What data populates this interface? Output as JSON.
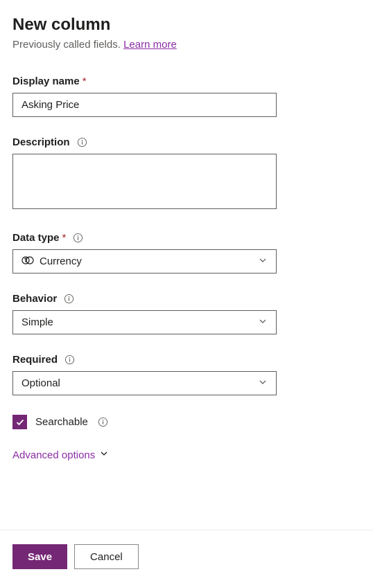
{
  "header": {
    "title": "New column",
    "subtitle_prefix": "Previously called fields. ",
    "learn_more": "Learn more"
  },
  "fields": {
    "display_name": {
      "label": "Display name",
      "required": true,
      "value": "Asking Price"
    },
    "description": {
      "label": "Description",
      "has_info": true,
      "value": ""
    },
    "data_type": {
      "label": "Data type",
      "required": true,
      "has_info": true,
      "selected": "Currency"
    },
    "behavior": {
      "label": "Behavior",
      "has_info": true,
      "selected": "Simple"
    },
    "required_field": {
      "label": "Required",
      "has_info": true,
      "selected": "Optional"
    },
    "searchable": {
      "label": "Searchable",
      "checked": true,
      "has_info": true
    }
  },
  "advanced": {
    "label": "Advanced options"
  },
  "footer": {
    "save": "Save",
    "cancel": "Cancel"
  },
  "colors": {
    "accent": "#742774",
    "link": "#8a2da5"
  }
}
